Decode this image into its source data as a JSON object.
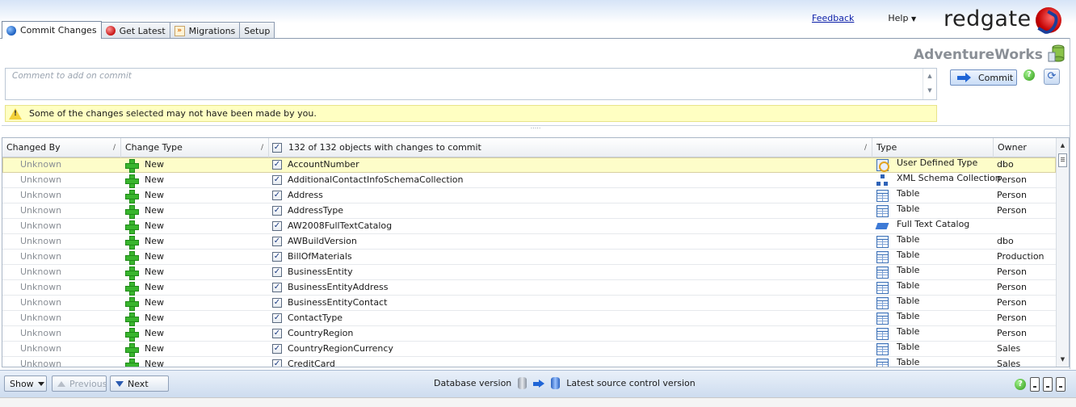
{
  "tabs": [
    {
      "label": "Commit Changes",
      "icon": "blue-circle-icon",
      "active": true
    },
    {
      "label": "Get Latest",
      "icon": "red-circle-icon",
      "active": false
    },
    {
      "label": "Migrations",
      "icon": "migrations-icon",
      "active": false
    },
    {
      "label": "Setup",
      "icon": "",
      "active": false
    }
  ],
  "header": {
    "feedback": "Feedback",
    "help": "Help",
    "brand": "redgate"
  },
  "database": {
    "name": "AdventureWorks"
  },
  "comment": {
    "placeholder": "Comment to add on commit"
  },
  "commit_button": "Commit",
  "warning": "Some of the changes selected may not have been made by you.",
  "grid": {
    "columns": {
      "changed_by": "Changed By",
      "change_type": "Change Type",
      "objects": "132 of 132 objects with changes to commit",
      "type": "Type",
      "owner": "Owner"
    },
    "rows": [
      {
        "changed_by": "Unknown",
        "change_type": "New",
        "name": "AccountNumber",
        "type": "User Defined Type",
        "type_icon": "udt",
        "owner": "dbo"
      },
      {
        "changed_by": "Unknown",
        "change_type": "New",
        "name": "AdditionalContactInfoSchemaCollection",
        "type": "XML Schema Collection",
        "type_icon": "xml",
        "owner": "Person"
      },
      {
        "changed_by": "Unknown",
        "change_type": "New",
        "name": "Address",
        "type": "Table",
        "type_icon": "table",
        "owner": "Person"
      },
      {
        "changed_by": "Unknown",
        "change_type": "New",
        "name": "AddressType",
        "type": "Table",
        "type_icon": "table",
        "owner": "Person"
      },
      {
        "changed_by": "Unknown",
        "change_type": "New",
        "name": "AW2008FullTextCatalog",
        "type": "Full Text Catalog",
        "type_icon": "ftc",
        "owner": ""
      },
      {
        "changed_by": "Unknown",
        "change_type": "New",
        "name": "AWBuildVersion",
        "type": "Table",
        "type_icon": "table",
        "owner": "dbo"
      },
      {
        "changed_by": "Unknown",
        "change_type": "New",
        "name": "BillOfMaterials",
        "type": "Table",
        "type_icon": "table",
        "owner": "Production"
      },
      {
        "changed_by": "Unknown",
        "change_type": "New",
        "name": "BusinessEntity",
        "type": "Table",
        "type_icon": "table",
        "owner": "Person"
      },
      {
        "changed_by": "Unknown",
        "change_type": "New",
        "name": "BusinessEntityAddress",
        "type": "Table",
        "type_icon": "table",
        "owner": "Person"
      },
      {
        "changed_by": "Unknown",
        "change_type": "New",
        "name": "BusinessEntityContact",
        "type": "Table",
        "type_icon": "table",
        "owner": "Person"
      },
      {
        "changed_by": "Unknown",
        "change_type": "New",
        "name": "ContactType",
        "type": "Table",
        "type_icon": "table",
        "owner": "Person"
      },
      {
        "changed_by": "Unknown",
        "change_type": "New",
        "name": "CountryRegion",
        "type": "Table",
        "type_icon": "table",
        "owner": "Person"
      },
      {
        "changed_by": "Unknown",
        "change_type": "New",
        "name": "CountryRegionCurrency",
        "type": "Table",
        "type_icon": "table",
        "owner": "Sales"
      },
      {
        "changed_by": "Unknown",
        "change_type": "New",
        "name": "CreditCard",
        "type": "Table",
        "type_icon": "table",
        "owner": "Sales"
      }
    ]
  },
  "footer": {
    "show": "Show",
    "previous": "Previous",
    "next": "Next",
    "db_version": "Database version",
    "source_version": "Latest source control version"
  }
}
